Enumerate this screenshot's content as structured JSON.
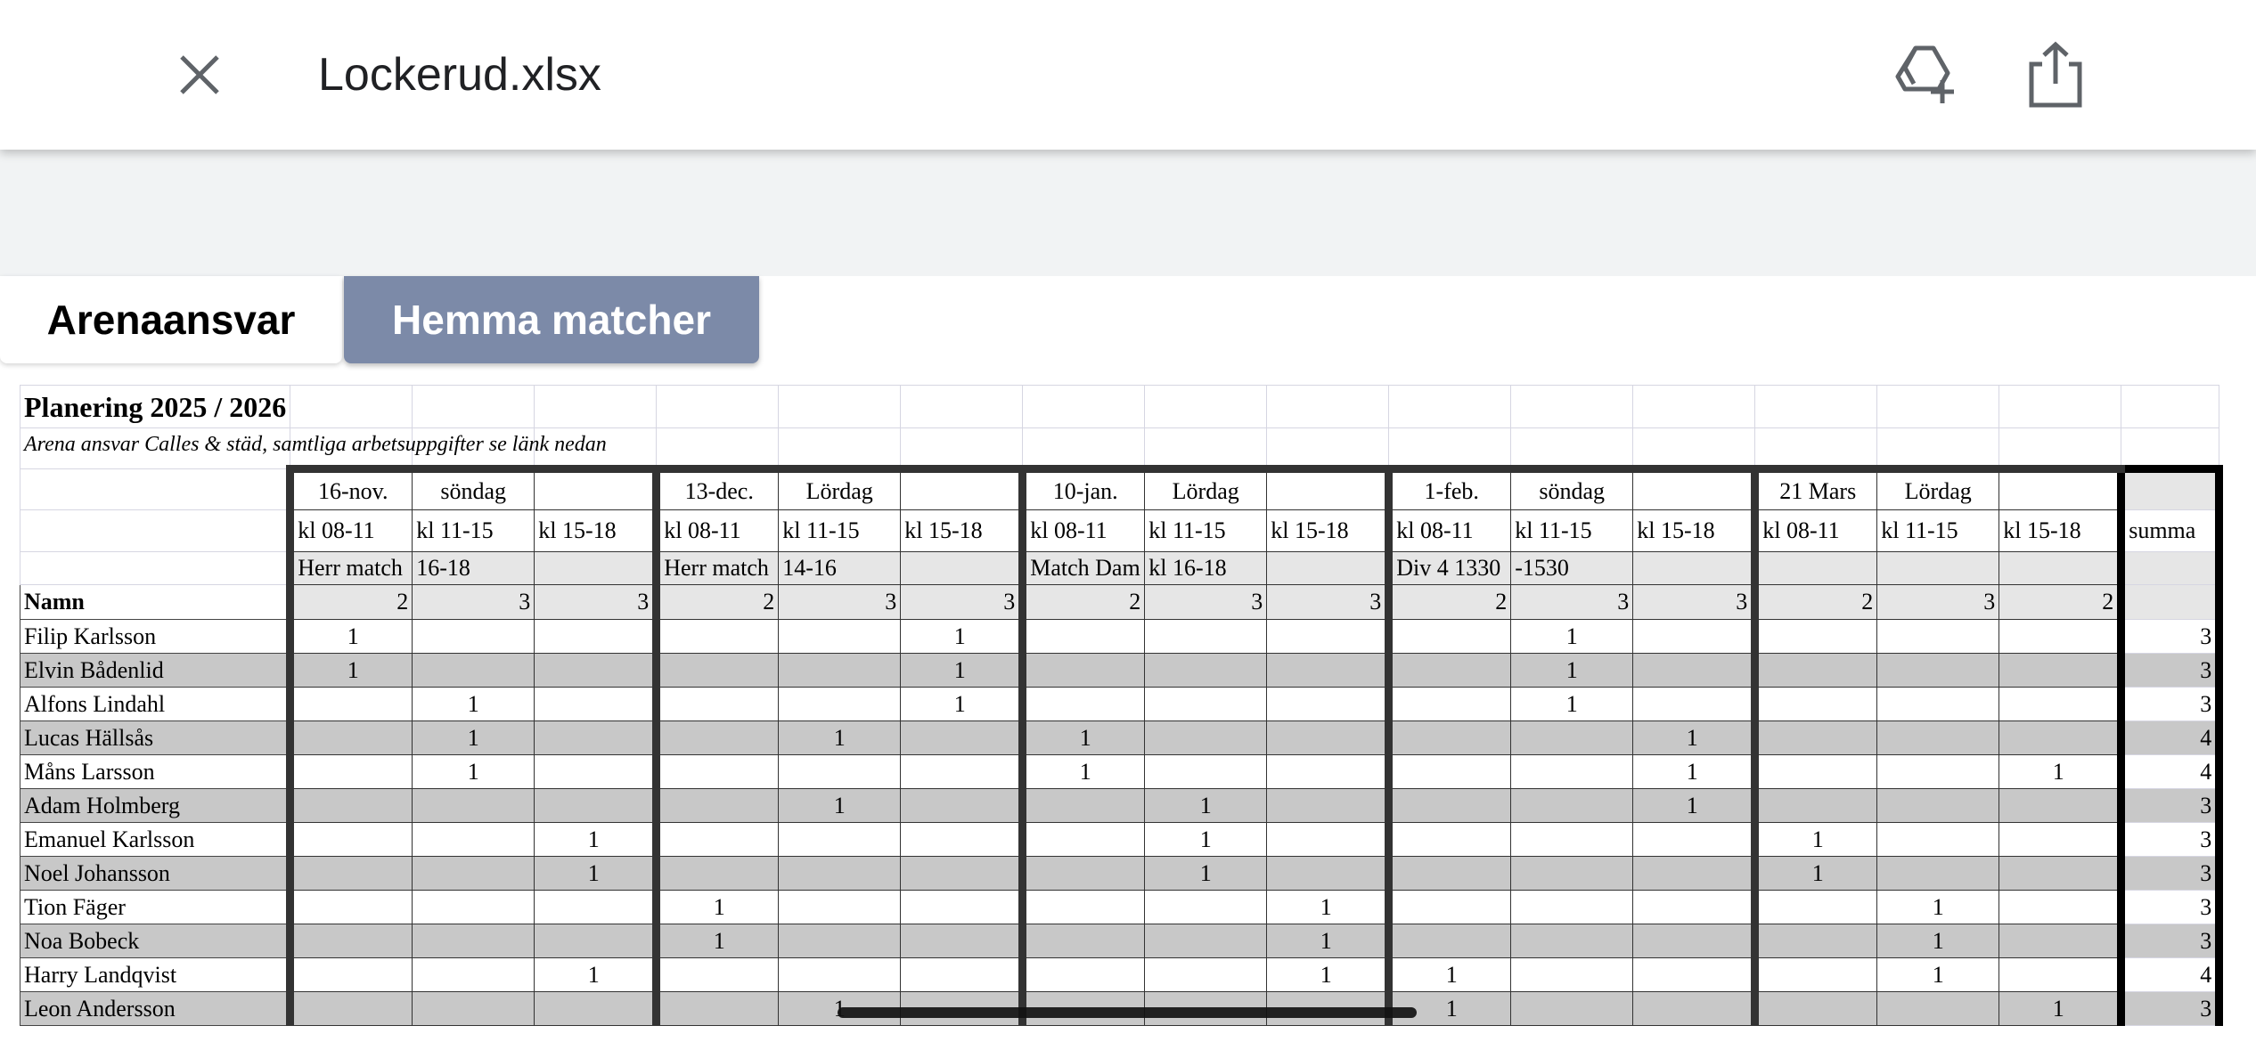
{
  "header": {
    "close_icon": "close-icon",
    "title": "Lockerud.xlsx",
    "add_to_drive_icon": "add-to-drive-icon",
    "share_icon": "share-icon"
  },
  "tabs": [
    {
      "label": "Arenaansvar",
      "active": true
    },
    {
      "label": "Hemma matcher",
      "active": false
    }
  ],
  "sheet": {
    "title": "Planering 2025 / 2026",
    "subtitle": "Arena ansvar  Calles & städ, samtliga arbetsuppgifter se länk nedan",
    "dates": [
      "16-nov.",
      "söndag",
      "",
      "13-dec.",
      "Lördag",
      "",
      "10-jan.",
      "Lördag",
      "",
      "1-feb.",
      "söndag",
      "",
      "21 Mars",
      "Lördag",
      ""
    ],
    "times": [
      "kl 08-11",
      "kl 11-15",
      "kl 15-18",
      "kl 08-11",
      "kl 11-15",
      "kl 15-18",
      "kl 08-11",
      "kl 11-15",
      "kl 15-18",
      "kl 08-11",
      "kl 11-15",
      "kl 15-18",
      "kl 08-11",
      "kl 11-15",
      "kl 15-18"
    ],
    "summa_label": "summa",
    "events": [
      "Herr match",
      "16-18",
      "",
      "Herr match",
      "14-16",
      "",
      "Match Dam",
      "kl 16-18",
      "",
      "Div 4 1330",
      "-1530",
      "",
      "",
      "",
      ""
    ],
    "name_header": "Namn",
    "needed": [
      "2",
      "3",
      "3",
      "2",
      "3",
      "3",
      "2",
      "3",
      "3",
      "2",
      "3",
      "3",
      "2",
      "3",
      "2"
    ],
    "rows": [
      {
        "name": "Filip Karlsson",
        "cells": [
          "1",
          "",
          "",
          "",
          "",
          "1",
          "",
          "",
          "",
          "",
          "1",
          "",
          "",
          "",
          ""
        ],
        "sum": "3"
      },
      {
        "name": "Elvin Bådenlid",
        "cells": [
          "1",
          "",
          "",
          "",
          "",
          "1",
          "",
          "",
          "",
          "",
          "1",
          "",
          "",
          "",
          ""
        ],
        "sum": "3"
      },
      {
        "name": "Alfons Lindahl",
        "cells": [
          "",
          "1",
          "",
          "",
          "",
          "1",
          "",
          "",
          "",
          "",
          "1",
          "",
          "",
          "",
          ""
        ],
        "sum": "3"
      },
      {
        "name": "Lucas Hällsås",
        "cells": [
          "",
          "1",
          "",
          "",
          "1",
          "",
          "1",
          "",
          "",
          "",
          "",
          "1",
          "",
          "",
          ""
        ],
        "sum": "4"
      },
      {
        "name": "Måns Larsson",
        "cells": [
          "",
          "1",
          "",
          "",
          "",
          "",
          "1",
          "",
          "",
          "",
          "",
          "1",
          "",
          "",
          "1"
        ],
        "sum": "4"
      },
      {
        "name": "Adam Holmberg",
        "cells": [
          "",
          "",
          "",
          "",
          "1",
          "",
          "",
          "1",
          "",
          "",
          "",
          "1",
          "",
          "",
          ""
        ],
        "sum": "3"
      },
      {
        "name": "Emanuel Karlsson",
        "cells": [
          "",
          "",
          "1",
          "",
          "",
          "",
          "",
          "1",
          "",
          "",
          "",
          "",
          "1",
          "",
          ""
        ],
        "sum": "3"
      },
      {
        "name": "Noel Johansson",
        "cells": [
          "",
          "",
          "1",
          "",
          "",
          "",
          "",
          "1",
          "",
          "",
          "",
          "",
          "1",
          "",
          ""
        ],
        "sum": "3"
      },
      {
        "name": "Tion Fäger",
        "cells": [
          "",
          "",
          "",
          "1",
          "",
          "",
          "",
          "",
          "1",
          "",
          "",
          "",
          "",
          "1",
          ""
        ],
        "sum": "3"
      },
      {
        "name": "Noa Bobeck",
        "cells": [
          "",
          "",
          "",
          "1",
          "",
          "",
          "",
          "",
          "1",
          "",
          "",
          "",
          "",
          "1",
          ""
        ],
        "sum": "3"
      },
      {
        "name": "Harry Landqvist",
        "cells": [
          "",
          "",
          "1",
          "",
          "",
          "",
          "",
          "",
          "1",
          "1",
          "",
          "",
          "",
          "1",
          ""
        ],
        "sum": "4"
      },
      {
        "name": "Leon Andersson",
        "cells": [
          "",
          "",
          "",
          "",
          "1",
          "",
          "",
          "",
          "",
          "1",
          "",
          "",
          "",
          "",
          "1"
        ],
        "sum": "3"
      }
    ]
  }
}
